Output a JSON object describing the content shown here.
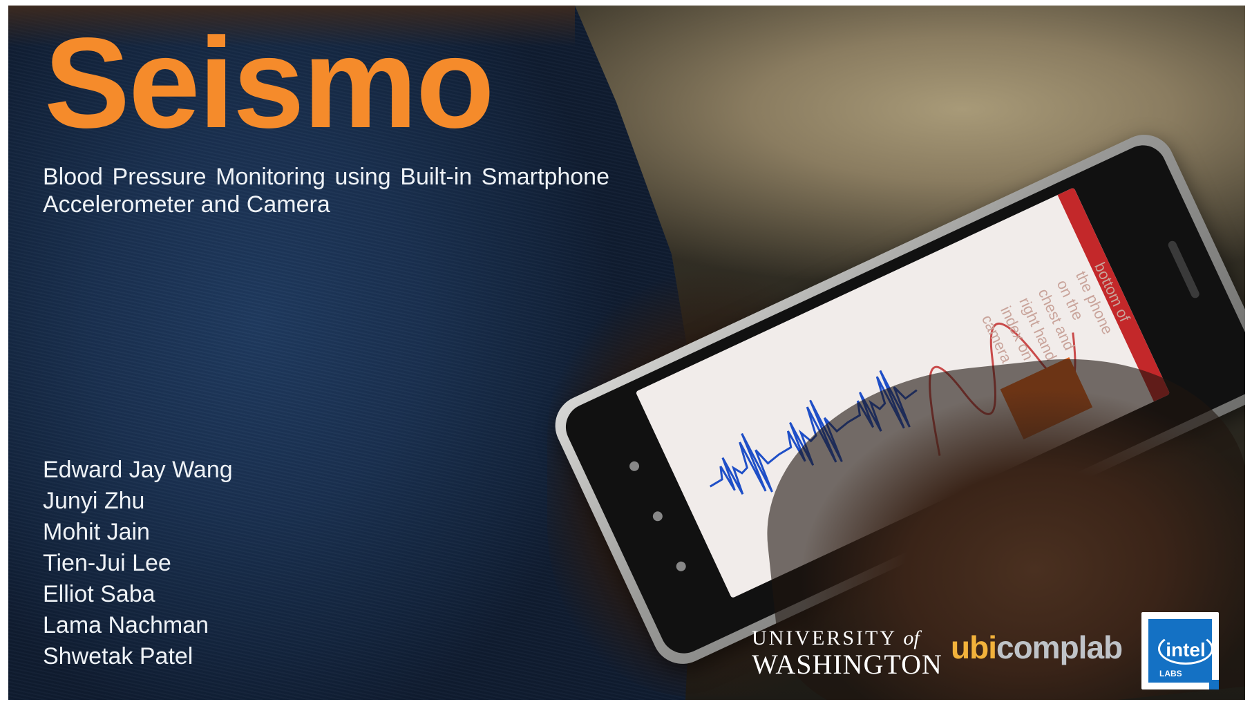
{
  "slide": {
    "title": "Seismo",
    "subtitle": "Blood Pressure Monitoring using Built-in Smartphone Accelerometer and Camera",
    "authors": [
      "Edward Jay Wang",
      "Junyi Zhu",
      "Mohit Jain",
      "Tien-Jui Lee",
      "Elliot Saba",
      "Lama Nachman",
      "Shwetak Patel"
    ]
  },
  "phone_screen": {
    "instruction": "Place right side bottom of the phone on the chest and right hand index on camera"
  },
  "logos": {
    "uw_top": "UNIVERSITY",
    "uw_of": "of",
    "uw_bottom": "WASHINGTON",
    "ubi_a": "ubi",
    "ubi_b": "comp",
    "ubi_c": "lab",
    "intel_word": "intel",
    "intel_labs": "LABS"
  },
  "colors": {
    "title": "#f58b2b",
    "waveform_blue": "#1f4fc7",
    "waveform_red": "#c94a4a",
    "intel_blue": "#1471c4"
  }
}
